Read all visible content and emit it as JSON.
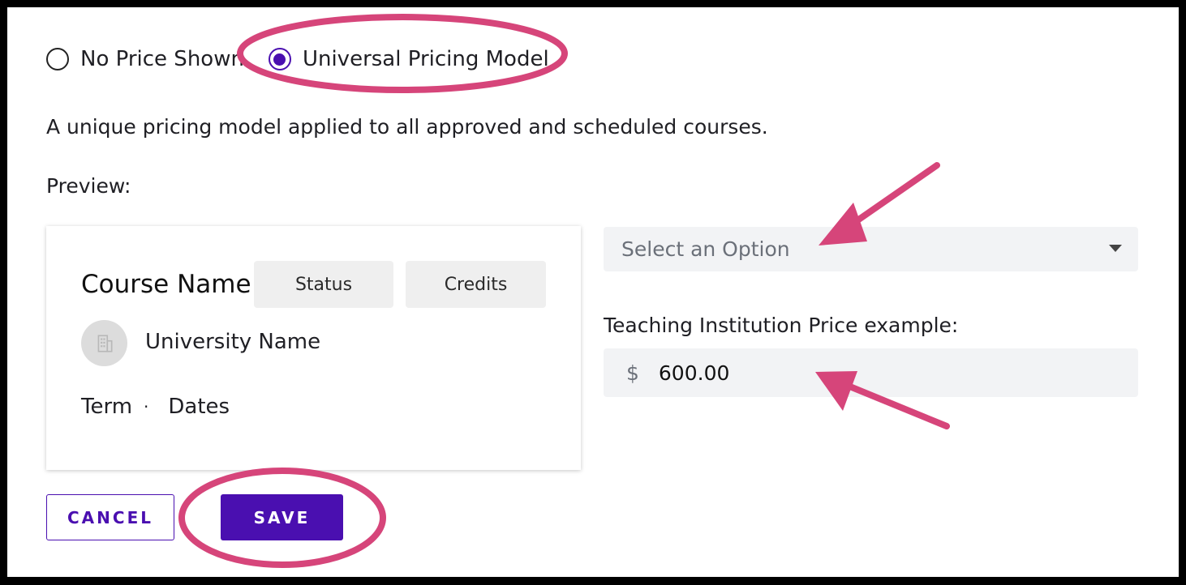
{
  "pricing_options": {
    "no_price": {
      "label": "No Price Shown",
      "checked": false
    },
    "universal": {
      "label": "Universal Pricing Model",
      "checked": true
    }
  },
  "description": "A unique pricing model applied to all approved and scheduled courses.",
  "preview_label": "Preview:",
  "preview_card": {
    "course_name": "Course Name",
    "status_chip": "Status",
    "credits_chip": "Credits",
    "university_name": "University Name",
    "term": "Term",
    "separator": "·",
    "dates": "Dates"
  },
  "option_select": {
    "placeholder": "Select an Option"
  },
  "price": {
    "label": "Teaching Institution Price example:",
    "prefix": "$",
    "value": "600.00"
  },
  "buttons": {
    "cancel": "CANCEL",
    "save": "SAVE"
  },
  "colors": {
    "accent": "#4a0fb0",
    "annotation": "#d6457a"
  },
  "icons": {
    "university": "building-icon",
    "select_caret": "caret-down-icon"
  }
}
